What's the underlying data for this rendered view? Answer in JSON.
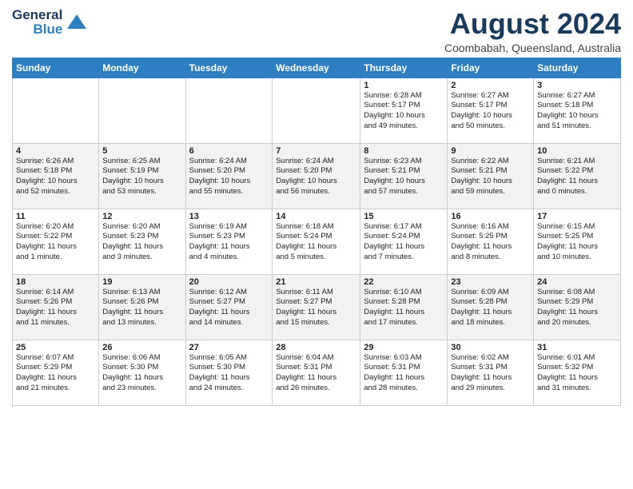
{
  "logo": {
    "line1": "General",
    "line2": "Blue"
  },
  "title": "August 2024",
  "subtitle": "Coombabah, Queensland, Australia",
  "weekdays": [
    "Sunday",
    "Monday",
    "Tuesday",
    "Wednesday",
    "Thursday",
    "Friday",
    "Saturday"
  ],
  "weeks": [
    [
      {
        "day": "",
        "info": ""
      },
      {
        "day": "",
        "info": ""
      },
      {
        "day": "",
        "info": ""
      },
      {
        "day": "",
        "info": ""
      },
      {
        "day": "1",
        "info": "Sunrise: 6:28 AM\nSunset: 5:17 PM\nDaylight: 10 hours\nand 49 minutes."
      },
      {
        "day": "2",
        "info": "Sunrise: 6:27 AM\nSunset: 5:17 PM\nDaylight: 10 hours\nand 50 minutes."
      },
      {
        "day": "3",
        "info": "Sunrise: 6:27 AM\nSunset: 5:18 PM\nDaylight: 10 hours\nand 51 minutes."
      }
    ],
    [
      {
        "day": "4",
        "info": "Sunrise: 6:26 AM\nSunset: 5:18 PM\nDaylight: 10 hours\nand 52 minutes."
      },
      {
        "day": "5",
        "info": "Sunrise: 6:25 AM\nSunset: 5:19 PM\nDaylight: 10 hours\nand 53 minutes."
      },
      {
        "day": "6",
        "info": "Sunrise: 6:24 AM\nSunset: 5:20 PM\nDaylight: 10 hours\nand 55 minutes."
      },
      {
        "day": "7",
        "info": "Sunrise: 6:24 AM\nSunset: 5:20 PM\nDaylight: 10 hours\nand 56 minutes."
      },
      {
        "day": "8",
        "info": "Sunrise: 6:23 AM\nSunset: 5:21 PM\nDaylight: 10 hours\nand 57 minutes."
      },
      {
        "day": "9",
        "info": "Sunrise: 6:22 AM\nSunset: 5:21 PM\nDaylight: 10 hours\nand 59 minutes."
      },
      {
        "day": "10",
        "info": "Sunrise: 6:21 AM\nSunset: 5:22 PM\nDaylight: 11 hours\nand 0 minutes."
      }
    ],
    [
      {
        "day": "11",
        "info": "Sunrise: 6:20 AM\nSunset: 5:22 PM\nDaylight: 11 hours\nand 1 minute."
      },
      {
        "day": "12",
        "info": "Sunrise: 6:20 AM\nSunset: 5:23 PM\nDaylight: 11 hours\nand 3 minutes."
      },
      {
        "day": "13",
        "info": "Sunrise: 6:19 AM\nSunset: 5:23 PM\nDaylight: 11 hours\nand 4 minutes."
      },
      {
        "day": "14",
        "info": "Sunrise: 6:18 AM\nSunset: 5:24 PM\nDaylight: 11 hours\nand 5 minutes."
      },
      {
        "day": "15",
        "info": "Sunrise: 6:17 AM\nSunset: 5:24 PM\nDaylight: 11 hours\nand 7 minutes."
      },
      {
        "day": "16",
        "info": "Sunrise: 6:16 AM\nSunset: 5:25 PM\nDaylight: 11 hours\nand 8 minutes."
      },
      {
        "day": "17",
        "info": "Sunrise: 6:15 AM\nSunset: 5:25 PM\nDaylight: 11 hours\nand 10 minutes."
      }
    ],
    [
      {
        "day": "18",
        "info": "Sunrise: 6:14 AM\nSunset: 5:26 PM\nDaylight: 11 hours\nand 11 minutes."
      },
      {
        "day": "19",
        "info": "Sunrise: 6:13 AM\nSunset: 5:26 PM\nDaylight: 11 hours\nand 13 minutes."
      },
      {
        "day": "20",
        "info": "Sunrise: 6:12 AM\nSunset: 5:27 PM\nDaylight: 11 hours\nand 14 minutes."
      },
      {
        "day": "21",
        "info": "Sunrise: 6:11 AM\nSunset: 5:27 PM\nDaylight: 11 hours\nand 15 minutes."
      },
      {
        "day": "22",
        "info": "Sunrise: 6:10 AM\nSunset: 5:28 PM\nDaylight: 11 hours\nand 17 minutes."
      },
      {
        "day": "23",
        "info": "Sunrise: 6:09 AM\nSunset: 5:28 PM\nDaylight: 11 hours\nand 18 minutes."
      },
      {
        "day": "24",
        "info": "Sunrise: 6:08 AM\nSunset: 5:29 PM\nDaylight: 11 hours\nand 20 minutes."
      }
    ],
    [
      {
        "day": "25",
        "info": "Sunrise: 6:07 AM\nSunset: 5:29 PM\nDaylight: 11 hours\nand 21 minutes."
      },
      {
        "day": "26",
        "info": "Sunrise: 6:06 AM\nSunset: 5:30 PM\nDaylight: 11 hours\nand 23 minutes."
      },
      {
        "day": "27",
        "info": "Sunrise: 6:05 AM\nSunset: 5:30 PM\nDaylight: 11 hours\nand 24 minutes."
      },
      {
        "day": "28",
        "info": "Sunrise: 6:04 AM\nSunset: 5:31 PM\nDaylight: 11 hours\nand 26 minutes."
      },
      {
        "day": "29",
        "info": "Sunrise: 6:03 AM\nSunset: 5:31 PM\nDaylight: 11 hours\nand 28 minutes."
      },
      {
        "day": "30",
        "info": "Sunrise: 6:02 AM\nSunset: 5:31 PM\nDaylight: 11 hours\nand 29 minutes."
      },
      {
        "day": "31",
        "info": "Sunrise: 6:01 AM\nSunset: 5:32 PM\nDaylight: 11 hours\nand 31 minutes."
      }
    ]
  ]
}
